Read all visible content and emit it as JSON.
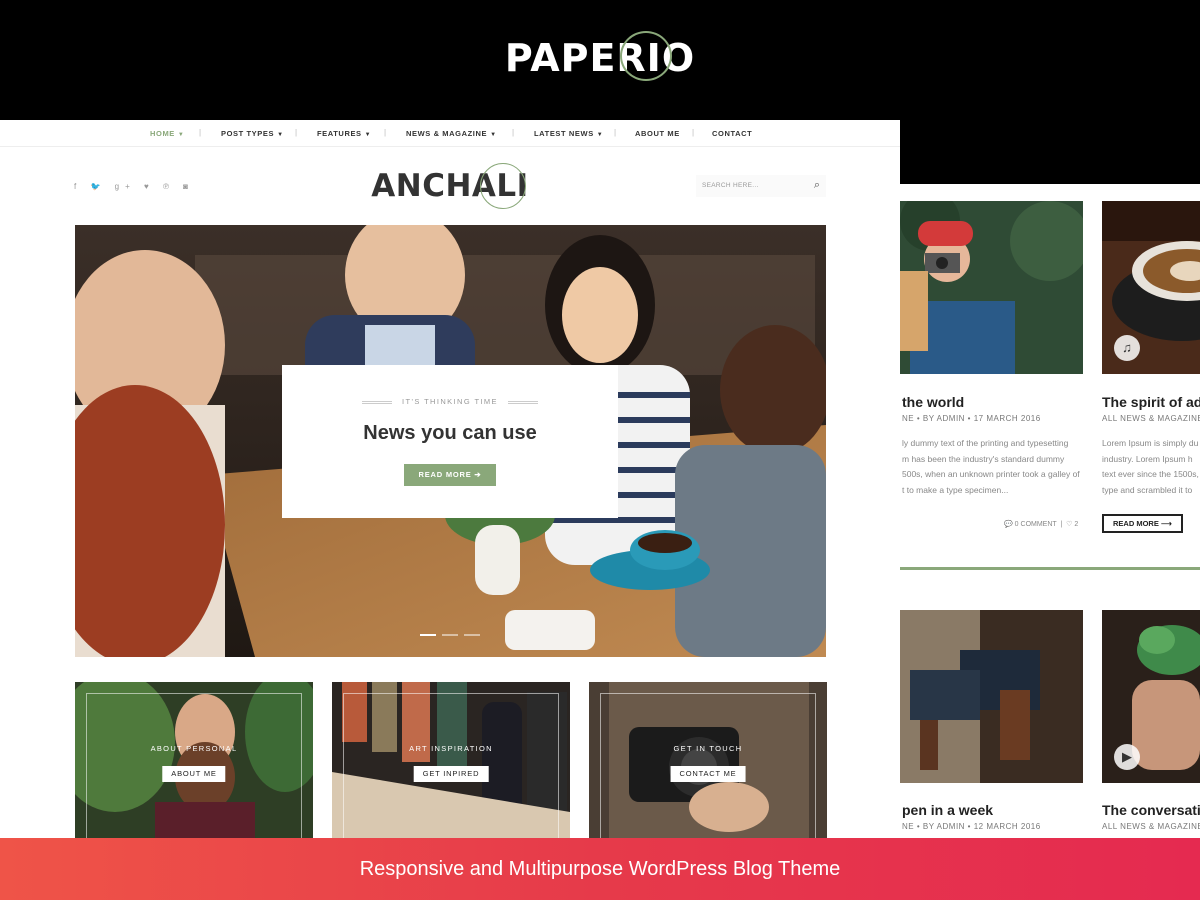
{
  "brand": {
    "logo_text": "PAPERIO"
  },
  "colors": {
    "accent": "#8aa87a",
    "banner_start": "#ef5448",
    "banner_end": "#e52a50"
  },
  "nav": {
    "items": [
      {
        "label": "HOME",
        "dropdown": true,
        "active": true
      },
      {
        "label": "POST TYPES",
        "dropdown": true
      },
      {
        "label": "FEATURES",
        "dropdown": true
      },
      {
        "label": "NEWS & MAGAZINE",
        "dropdown": true
      },
      {
        "label": "LATEST NEWS",
        "dropdown": true
      },
      {
        "label": "ABOUT ME",
        "dropdown": false
      },
      {
        "label": "CONTACT",
        "dropdown": false
      }
    ]
  },
  "social": {
    "icons": [
      "facebook-icon",
      "twitter-icon",
      "google-plus-icon",
      "heart-icon",
      "pinterest-icon",
      "instagram-icon"
    ],
    "glyphs": "f  🐦  g+  ♥  ℗  ◙"
  },
  "site": {
    "logo_text": "ANCHALI"
  },
  "search": {
    "placeholder": "SEARCH HERE..."
  },
  "hero": {
    "kicker": "IT'S THINKING TIME",
    "title": "News you can use",
    "button": "READ MORE",
    "slides": 3,
    "active_slide": 1
  },
  "promos": [
    {
      "kicker": "ABOUT PERSONAL",
      "button": "ABOUT ME"
    },
    {
      "kicker": "ART INSPIRATION",
      "button": "GET INPIRED"
    },
    {
      "kicker": "GET IN TOUCH",
      "button": "CONTACT ME"
    }
  ],
  "right_posts": [
    {
      "title": "the world",
      "meta": "NE • BY ADMIN • 17 MARCH 2016",
      "body": [
        "ly dummy text of the printing and typesetting",
        "m has been the industry's standard dummy",
        "500s, when an unknown printer took a galley of",
        "t to make a type specimen..."
      ],
      "comments": "0 COMMENT",
      "likes": "2"
    },
    {
      "title": "The spirit of ad",
      "meta": "ALL NEWS & MAGAZINE •",
      "body": [
        "Lorem Ipsum is simply du",
        "industry. Lorem Ipsum h",
        "text ever since the 1500s,",
        "type and scrambled it to"
      ],
      "button": "READ MORE",
      "media_icon": "music-note-icon"
    },
    {
      "title": "pen in a week",
      "meta": "NE • BY ADMIN • 12 MARCH 2016"
    },
    {
      "title": "The conversatio",
      "meta": "ALL NEWS & MAGAZINE •",
      "media_icon": "play-icon"
    }
  ],
  "banner": {
    "text": "Responsive and Multipurpose WordPress Blog Theme"
  }
}
